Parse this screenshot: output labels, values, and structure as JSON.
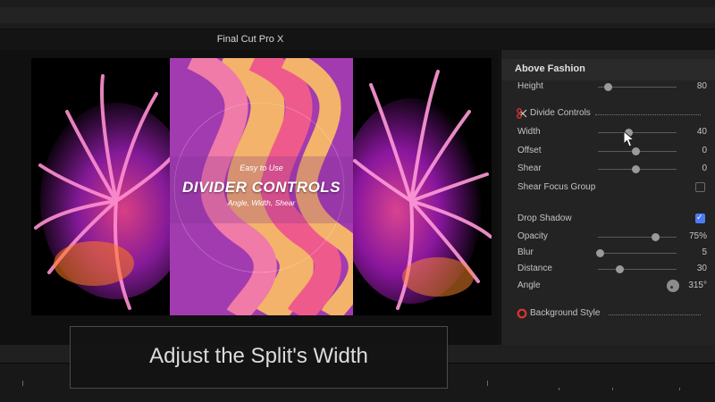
{
  "viewer": {
    "title": "Final Cut Pro X"
  },
  "poster": {
    "tagline": "Easy to Use",
    "headline": "DIVIDER CONTROLS",
    "subline": "Angle, Width, Shear"
  },
  "inspector": {
    "title": "Above Fashion",
    "height": {
      "label": "Height",
      "value": "80",
      "level": 0.12
    },
    "divide_controls": {
      "label": "Divide Controls"
    },
    "width": {
      "label": "Width",
      "value": "40",
      "level": 0.45
    },
    "offset": {
      "label": "Offset",
      "value": "0",
      "level": 0.5
    },
    "shear": {
      "label": "Shear",
      "value": "0",
      "level": 0.5
    },
    "shear_focus_group": {
      "label": "Shear Focus Group",
      "checked": false
    },
    "drop_shadow": {
      "label": "Drop Shadow",
      "checked": true
    },
    "opacity": {
      "label": "Opacity",
      "value": "75%",
      "level": 0.75
    },
    "blur": {
      "label": "Blur",
      "value": "5",
      "level": 0.03
    },
    "distance": {
      "label": "Distance",
      "value": "30",
      "level": 0.28
    },
    "angle": {
      "label": "Angle",
      "value": "315°"
    },
    "background_style": {
      "label": "Background Style"
    }
  },
  "caption": {
    "text": "Adjust the Split's Width"
  },
  "colors": {
    "accent": "#4d7bf4",
    "section_icon": "#e0332d"
  }
}
